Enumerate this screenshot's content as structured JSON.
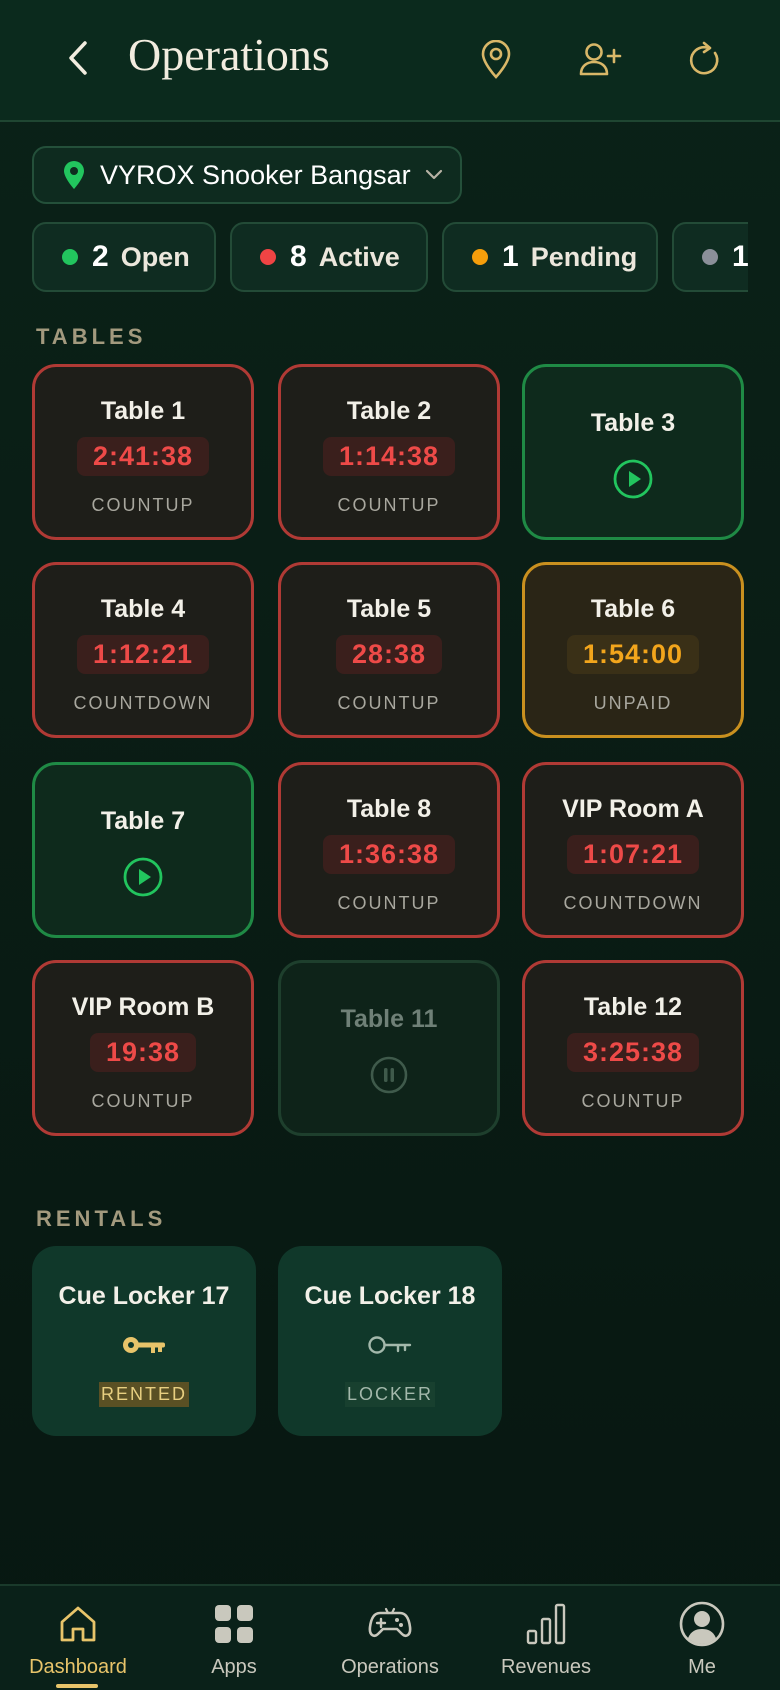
{
  "header": {
    "title": "Operations"
  },
  "venue": {
    "name": "VYROX Snooker Bangsar"
  },
  "status_chips": [
    {
      "count": "2",
      "label": "Open",
      "color": "#22c55e"
    },
    {
      "count": "8",
      "label": "Active",
      "color": "#ef4444"
    },
    {
      "count": "1",
      "label": "Pending",
      "color": "#f59e0b"
    },
    {
      "count": "1",
      "label": "",
      "color": "#8b8f99"
    }
  ],
  "sections": {
    "tables": "TABLES",
    "rentals": "RENTALS"
  },
  "tables": [
    {
      "name": "Table 1",
      "timer": "2:41:38",
      "mode": "COUNTUP",
      "state": "active"
    },
    {
      "name": "Table 2",
      "timer": "1:14:38",
      "mode": "COUNTUP",
      "state": "active"
    },
    {
      "name": "Table 3",
      "state": "open",
      "icon": "play-icon"
    },
    {
      "name": "Table 4",
      "timer": "1:12:21",
      "mode": "COUNTDOWN",
      "state": "active"
    },
    {
      "name": "Table 5",
      "timer": "28:38",
      "mode": "COUNTUP",
      "state": "active"
    },
    {
      "name": "Table 6",
      "timer": "1:54:00",
      "mode": "UNPAID",
      "state": "pending"
    },
    {
      "name": "Table 7",
      "state": "open",
      "icon": "play-icon"
    },
    {
      "name": "Table 8",
      "timer": "1:36:38",
      "mode": "COUNTUP",
      "state": "active"
    },
    {
      "name": "VIP Room A",
      "timer": "1:07:21",
      "mode": "COUNTDOWN",
      "state": "active"
    },
    {
      "name": "VIP Room B",
      "timer": "19:38",
      "mode": "COUNTUP",
      "state": "active"
    },
    {
      "name": "Table 11",
      "state": "paused",
      "icon": "pause-icon"
    },
    {
      "name": "Table 12",
      "timer": "3:25:38",
      "mode": "COUNTUP",
      "state": "active"
    }
  ],
  "rentals": [
    {
      "name": "Cue Locker 17",
      "status": "RENTED",
      "icon": "key-icon"
    },
    {
      "name": "Cue Locker 18",
      "status": "LOCKER",
      "icon": "key-outline-icon"
    }
  ],
  "nav": [
    {
      "label": "Dashboard",
      "icon": "home-icon",
      "active": true
    },
    {
      "label": "Apps",
      "icon": "grid-icon"
    },
    {
      "label": "Operations",
      "icon": "gamepad-icon"
    },
    {
      "label": "Revenues",
      "icon": "bar-chart-icon"
    },
    {
      "label": "Me",
      "icon": "user-circle-icon"
    }
  ],
  "colors": {
    "accent_gold": "#e8c46a",
    "active_red": "#ef4444",
    "open_green": "#22c55e",
    "pending_amber": "#f59e0b",
    "background": "#0a1d15"
  }
}
